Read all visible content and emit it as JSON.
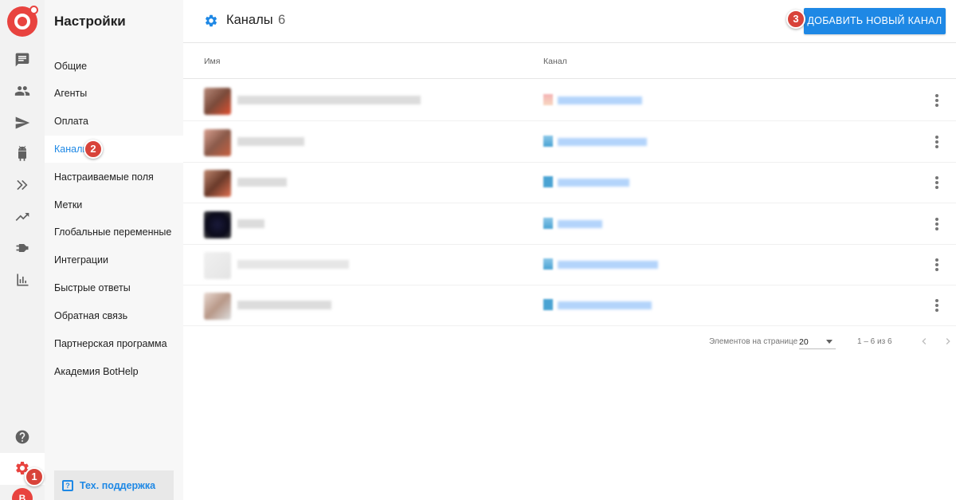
{
  "sidebar": {
    "title": "Настройки",
    "items": [
      {
        "label": "Общие"
      },
      {
        "label": "Агенты"
      },
      {
        "label": "Оплата"
      },
      {
        "label": "Каналы"
      },
      {
        "label": "Настраиваемые поля"
      },
      {
        "label": "Метки"
      },
      {
        "label": "Глобальные переменные"
      },
      {
        "label": "Интеграции"
      },
      {
        "label": "Быстрые ответы"
      },
      {
        "label": "Обратная связь"
      },
      {
        "label": "Партнерская программа"
      },
      {
        "label": "Академия BotHelp"
      }
    ],
    "support_label": "Тех. поддержка"
  },
  "rail": {
    "icons": [
      "chat-icon",
      "people-icon",
      "send-icon",
      "bot-icon",
      "chevrons-icon",
      "trending-icon",
      "plug-icon",
      "bar-chart-icon",
      "help-icon",
      "settings-icon"
    ],
    "avatar_letter": "B"
  },
  "header": {
    "title": "Каналы",
    "count": "6",
    "add_button": "ДОБАВИТЬ НОВЫЙ КАНАЛ"
  },
  "table": {
    "columns": {
      "name": "Имя",
      "channel": "Канал"
    }
  },
  "pager": {
    "per_page_label": "Элементов на странице",
    "per_page_value": "20",
    "range": "1 – 6 из 6"
  },
  "badges": {
    "one": "1",
    "two": "2",
    "three": "3"
  },
  "colors": {
    "accent": "#1e88e5",
    "brand_red": "#e8433f",
    "badge": "#d8433a"
  }
}
